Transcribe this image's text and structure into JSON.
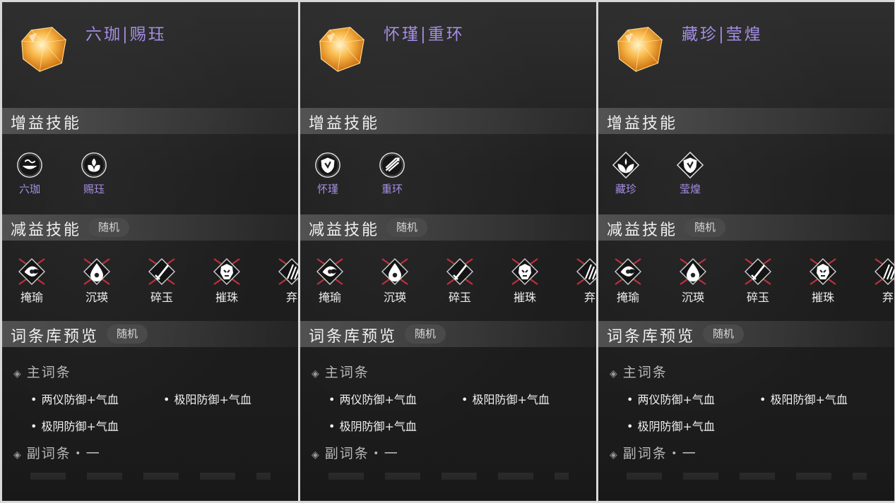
{
  "panels": [
    {
      "title": "六珈|赐珏",
      "buff_header": "增益技能",
      "buffs": [
        {
          "label": "六珈",
          "icon": "bowl-icon",
          "shape": "circle"
        },
        {
          "label": "赐珏",
          "icon": "flower-icon",
          "shape": "circle"
        }
      ],
      "debuff_header": "减益技能",
      "debuff_badge": "随机",
      "debuffs": [
        {
          "label": "掩瑜",
          "icon": "vortex-icon"
        },
        {
          "label": "沉瑛",
          "icon": "drop-icon"
        },
        {
          "label": "碎玉",
          "icon": "blade-icon"
        },
        {
          "label": "摧珠",
          "icon": "beast-icon"
        },
        {
          "label": "弃",
          "icon": "claw-icon"
        }
      ],
      "pool_header": "词条库预览",
      "pool_badge": "随机",
      "main_header": "主词条",
      "main_entries": [
        "两仪防御+气血",
        "极阳防御+气血",
        "极阴防御+气血"
      ],
      "sub_header": "副词条・一"
    },
    {
      "title": "怀瑾|重环",
      "buff_header": "增益技能",
      "buffs": [
        {
          "label": "怀瑾",
          "icon": "shield-icon",
          "shape": "circle"
        },
        {
          "label": "重环",
          "icon": "arrows-icon",
          "shape": "circle"
        }
      ],
      "debuff_header": "减益技能",
      "debuff_badge": "随机",
      "debuffs": [
        {
          "label": "掩瑜",
          "icon": "vortex-icon"
        },
        {
          "label": "沉瑛",
          "icon": "drop-icon"
        },
        {
          "label": "碎玉",
          "icon": "blade-icon"
        },
        {
          "label": "摧珠",
          "icon": "beast-icon"
        },
        {
          "label": "弃",
          "icon": "claw-icon"
        }
      ],
      "pool_header": "词条库预览",
      "pool_badge": "随机",
      "main_header": "主词条",
      "main_entries": [
        "两仪防御+气血",
        "极阳防御+气血",
        "极阴防御+气血"
      ],
      "sub_header": "副词条・一"
    },
    {
      "title": "藏珍|莹煌",
      "buff_header": "增益技能",
      "buffs": [
        {
          "label": "藏珍",
          "icon": "phoenix-icon",
          "shape": "diamond"
        },
        {
          "label": "莹煌",
          "icon": "shield-icon",
          "shape": "diamond"
        }
      ],
      "debuff_header": "减益技能",
      "debuff_badge": "随机",
      "debuffs": [
        {
          "label": "掩瑜",
          "icon": "vortex-icon"
        },
        {
          "label": "沉瑛",
          "icon": "drop-icon"
        },
        {
          "label": "碎玉",
          "icon": "blade-icon"
        },
        {
          "label": "摧珠",
          "icon": "beast-icon"
        },
        {
          "label": "弃",
          "icon": "claw-icon"
        }
      ],
      "pool_header": "词条库预览",
      "pool_badge": "随机",
      "main_header": "主词条",
      "main_entries": [
        "两仪防御+气血",
        "极阳防御+气血",
        "极阴防御+气血"
      ],
      "sub_header": "副词条・一"
    }
  ],
  "colors": {
    "title": "#a48ee4",
    "buff_label": "#a48ee4",
    "debuff_accent": "#c0303a",
    "gem_orange": "#f5a623"
  }
}
